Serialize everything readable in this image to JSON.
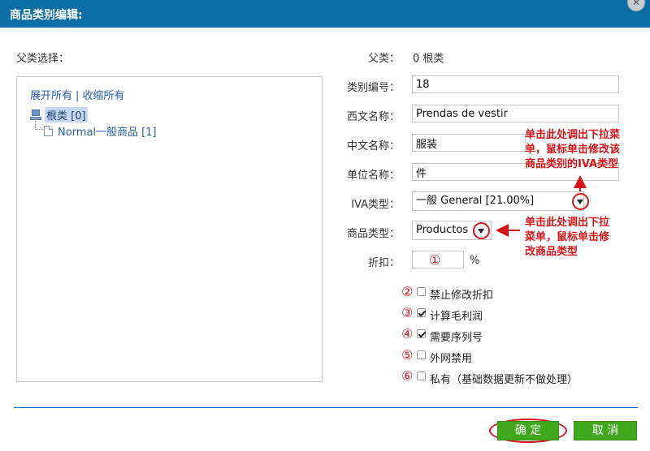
{
  "window": {
    "title": "商品类别编辑:"
  },
  "tree": {
    "heading": "父类选择：",
    "expand_all": "展开所有",
    "separator": "|",
    "collapse_all": "收缩所有",
    "root": "根类 [0]",
    "child": "Normal一般商品 [1]"
  },
  "form": {
    "parent_label": "父类：",
    "parent_value": "0 根类",
    "code_label": "类别编号：",
    "code_value": "18",
    "western_label": "西文名称：",
    "western_value": "Prendas de vestir",
    "chinese_label": "中文名称：",
    "chinese_value": "服装",
    "unit_label": "单位名称：",
    "unit_value": "件",
    "iva_label": "IVA类型：",
    "iva_value": "一般 General [21.00%]",
    "type_label": "商品类型：",
    "type_value": "Productos",
    "discount_label": "折扣：",
    "discount_value": "",
    "discount_unit": "%"
  },
  "checkboxes": [
    {
      "num": "②",
      "label": "禁止修改折扣",
      "checked": false
    },
    {
      "num": "③",
      "label": "计算毛利润",
      "checked": true
    },
    {
      "num": "④",
      "label": "需要序列号",
      "checked": true
    },
    {
      "num": "⑤",
      "label": "外网禁用",
      "checked": false
    },
    {
      "num": "⑥",
      "label": "私有（基础数据更新不做处理）",
      "checked": false
    }
  ],
  "annotations": {
    "discount_num": "①",
    "iva_note": [
      "单击此处调出下拉菜",
      "单，鼠标单击修改该",
      "商品类别的IVA类型"
    ],
    "type_note": [
      "单击此处调出下拉",
      "菜单，鼠标单击修",
      "改商品类型"
    ]
  },
  "buttons": {
    "ok": "确 定",
    "cancel": "取 消"
  },
  "colors": {
    "titlebar": "#0d6ea6",
    "accent_red": "#d4151b",
    "button_green": "#3fa81d",
    "link_blue": "#2a5da8"
  }
}
